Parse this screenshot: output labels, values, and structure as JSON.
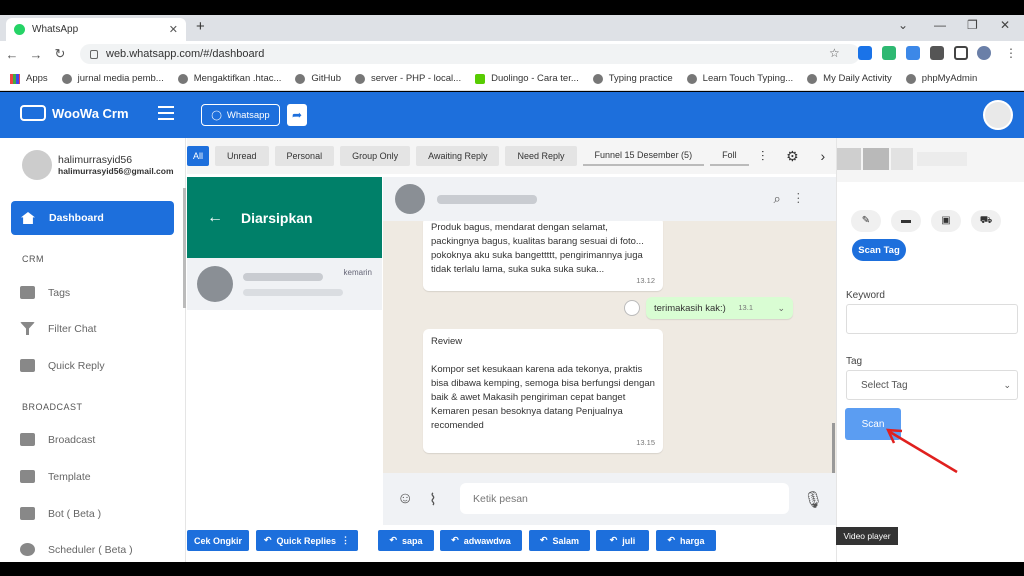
{
  "browser": {
    "tab_title": "WhatsApp",
    "url": "web.whatsapp.com/#/dashboard",
    "bookmarks": [
      "Apps",
      "jurnal media pemb...",
      "Mengaktifkan .htac...",
      "GitHub",
      "server - PHP - local...",
      "Duolingo - Cara ter...",
      "Typing practice",
      "Learn Touch Typing...",
      "My Daily Activity",
      "phpMyAdmin"
    ]
  },
  "header": {
    "brand": "WooWa Crm",
    "whatsapp_button": "Whatsapp"
  },
  "user": {
    "name": "halimurrasyid56",
    "email": "halimurrasyid56@gmail.com"
  },
  "sidebar": {
    "dashboard": "Dashboard",
    "section_crm": "CRM",
    "tags": "Tags",
    "filter_chat": "Filter Chat",
    "quick_reply": "Quick Reply",
    "section_broadcast": "BROADCAST",
    "broadcast": "Broadcast",
    "template": "Template",
    "bot": "Bot ( Beta )",
    "scheduler": "Scheduler ( Beta )"
  },
  "filters": [
    "All",
    "Unread",
    "Personal",
    "Group Only",
    "Awaiting Reply",
    "Need Reply",
    "Funnel 15 Desember (5)",
    "Foll"
  ],
  "archive": {
    "title": "Diarsipkan",
    "contact_time": "kemarin"
  },
  "messages": {
    "m1_text": "Produk bagus, mendarat dengan selamat, packingnya bagus, kualitas barang sesuai di foto... pokoknya aku suka bangettttt, pengirimannya juga tidak terlalu lama, suka suka suka suka...",
    "m1_time": "13.12",
    "m2_text": "terimakasih kak:)",
    "m2_time": "13.1",
    "m3_title": "Review",
    "m3_text": "Kompor set kesukaan karena ada tekonya, praktis bisa dibawa kemping, semoga bisa berfungsi dengan baik & awet Makasih pengiriman cepat banget Kemaren pesan besoknya datang Penjualnya recomended",
    "m3_time": "13.15"
  },
  "compose": {
    "placeholder": "Ketik pesan"
  },
  "bottom": {
    "cek_ongkir": "Cek Ongkir",
    "quick_replies": "Quick Replies",
    "replies": [
      "sapa",
      "adwawdwa",
      "Salam",
      "juli",
      "harga"
    ]
  },
  "right": {
    "scan_tag": "Scan Tag",
    "keyword_label": "Keyword",
    "tag_label": "Tag",
    "tag_select": "Select Tag",
    "scan_button": "Scan"
  },
  "tooltip": "Video player",
  "colors": {
    "primary": "#1d6fdc",
    "wa_green": "#008069",
    "arrow": "#e0201e"
  }
}
